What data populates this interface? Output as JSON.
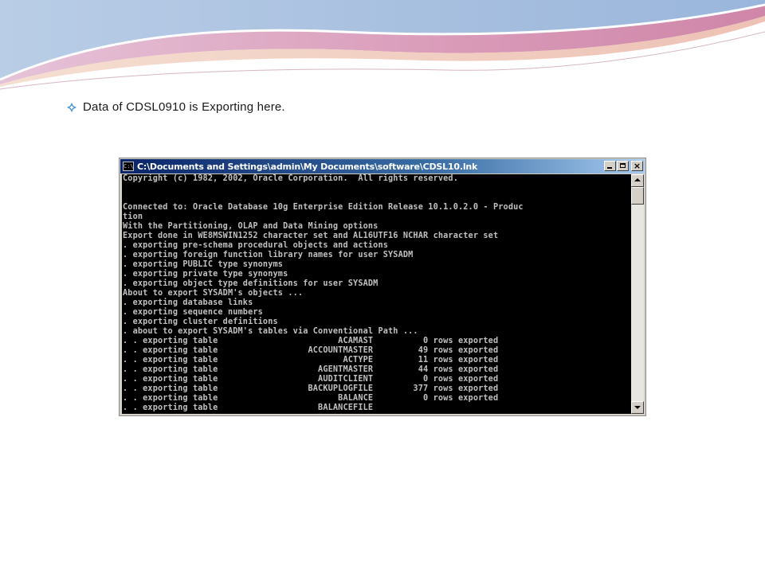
{
  "slide": {
    "bullet_text": "Data of CDSL0910 is Exporting here.",
    "bullet_icon": "diamond-bullet-icon",
    "bullet_color": "#4a90c8"
  },
  "window": {
    "title": "C:\\Documents and Settings\\admin\\My Documents\\software\\CDSL10.lnk",
    "icon": "command-prompt-icon",
    "title_icon_text": "C:\\",
    "close_label": "×",
    "scroll_position": 0.0,
    "console_lines": [
      "Copyright (c) 1982, 2002, Oracle Corporation.  All rights reserved.",
      "",
      "",
      "Connected to: Oracle Database 10g Enterprise Edition Release 10.1.0.2.0 - Produc",
      "tion",
      "With the Partitioning, OLAP and Data Mining options",
      "Export done in WE8MSWIN1252 character set and AL16UTF16 NCHAR character set",
      ". exporting pre-schema procedural objects and actions",
      ". exporting foreign function library names for user SYSADM",
      ". exporting PUBLIC type synonyms",
      ". exporting private type synonyms",
      ". exporting object type definitions for user SYSADM",
      "About to export SYSADM's objects ...",
      ". exporting database links",
      ". exporting sequence numbers",
      ". exporting cluster definitions",
      ". about to export SYSADM's tables via Conventional Path ...",
      ". . exporting table                        ACAMAST          0 rows exported",
      ". . exporting table                  ACCOUNTMASTER         49 rows exported",
      ". . exporting table                         ACTYPE         11 rows exported",
      ". . exporting table                    AGENTMASTER         44 rows exported",
      ". . exporting table                    AUDITCLIENT          0 rows exported",
      ". . exporting table                  BACKUPLOGFILE        377 rows exported",
      ". . exporting table                        BALANCE          0 rows exported",
      ". . exporting table                    BALANCEFILE"
    ]
  }
}
